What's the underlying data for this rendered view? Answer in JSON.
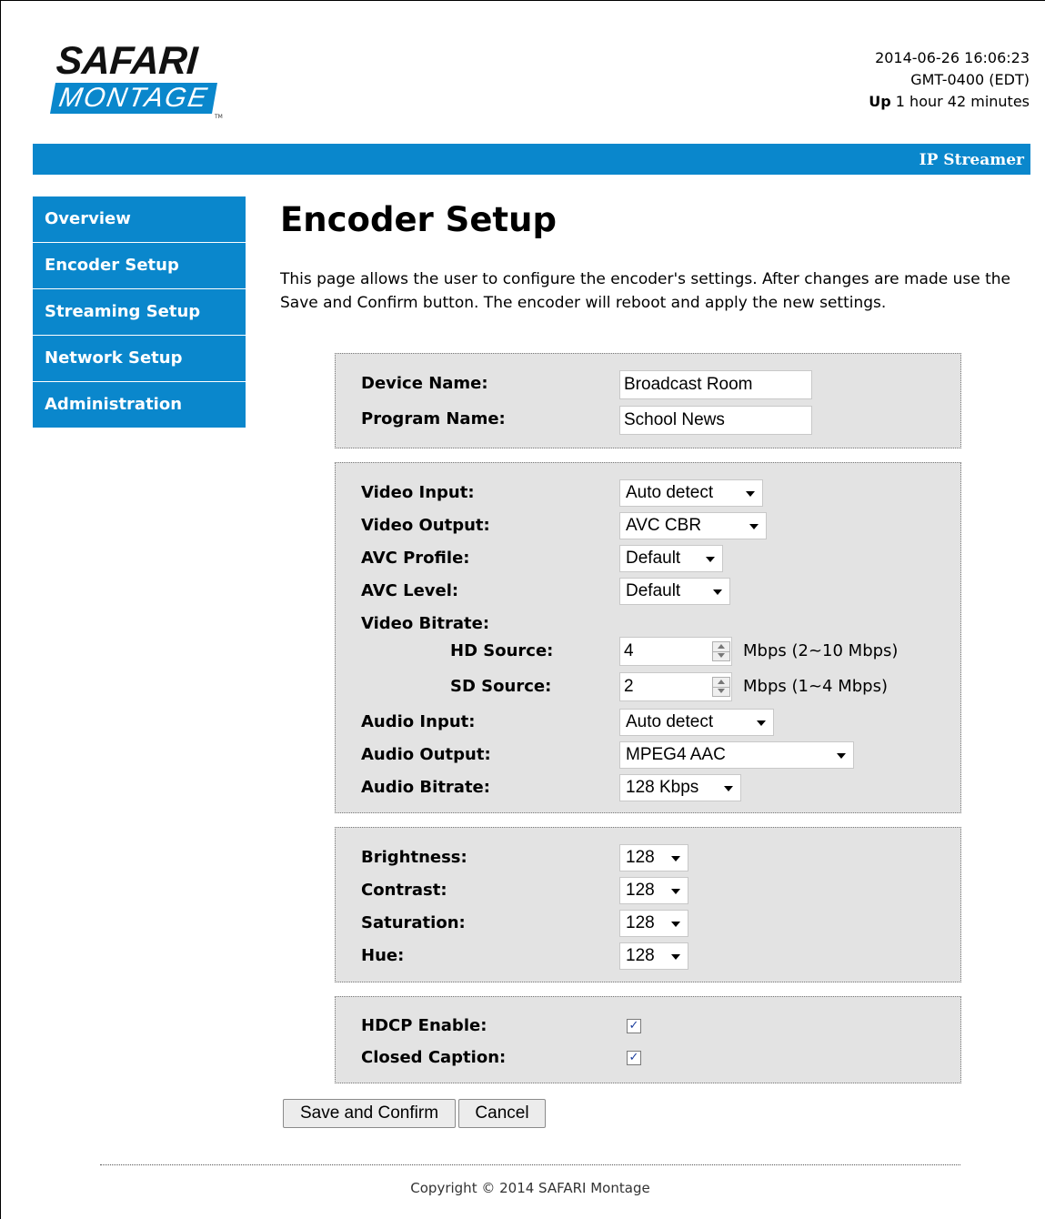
{
  "header": {
    "logo_top": "SAFARI",
    "logo_bottom": "MONTAGE",
    "logo_tm": "TM",
    "datetime": "2014-06-26 16:06:23",
    "timezone": "GMT-0400 (EDT)",
    "uptime_label": "Up",
    "uptime_value": "1 hour 42 minutes",
    "product": "IP Streamer",
    "accent_color": "#0a87cc"
  },
  "sidebar": {
    "items": [
      {
        "label": "Overview"
      },
      {
        "label": "Encoder Setup"
      },
      {
        "label": "Streaming Setup"
      },
      {
        "label": "Network Setup"
      },
      {
        "label": "Administration"
      }
    ]
  },
  "main": {
    "title": "Encoder Setup",
    "intro": "This page allows the user to configure the encoder's settings. After changes are made use the Save and Confirm button. The encoder will reboot and apply the new settings."
  },
  "device": {
    "device_name_label": "Device Name:",
    "device_name_value": "Broadcast Room",
    "program_name_label": "Program Name:",
    "program_name_value": "School News"
  },
  "video": {
    "video_input_label": "Video Input:",
    "video_input_value": "Auto detect",
    "video_output_label": "Video Output:",
    "video_output_value": "AVC CBR",
    "avc_profile_label": "AVC Profile:",
    "avc_profile_value": "Default",
    "avc_level_label": "AVC Level:",
    "avc_level_value": "Default",
    "video_bitrate_label": "Video Bitrate:",
    "hd_source_label": "HD Source:",
    "hd_source_value": "4",
    "hd_source_unit": "Mbps (2~10 Mbps)",
    "sd_source_label": "SD Source:",
    "sd_source_value": "2",
    "sd_source_unit": "Mbps (1~4 Mbps)",
    "audio_input_label": "Audio Input:",
    "audio_input_value": "Auto detect",
    "audio_output_label": "Audio Output:",
    "audio_output_value": "MPEG4 AAC",
    "audio_bitrate_label": "Audio Bitrate:",
    "audio_bitrate_value": "128 Kbps"
  },
  "image": {
    "brightness_label": "Brightness:",
    "brightness_value": "128",
    "contrast_label": "Contrast:",
    "contrast_value": "128",
    "saturation_label": "Saturation:",
    "saturation_value": "128",
    "hue_label": "Hue:",
    "hue_value": "128"
  },
  "options": {
    "hdcp_label": "HDCP Enable:",
    "hdcp_checked": true,
    "caption_label": "Closed Caption:",
    "caption_checked": true,
    "check_mark": "✓"
  },
  "actions": {
    "save_label": "Save and Confirm",
    "cancel_label": "Cancel"
  },
  "footer": {
    "copyright": "Copyright © 2014 SAFARI Montage"
  }
}
